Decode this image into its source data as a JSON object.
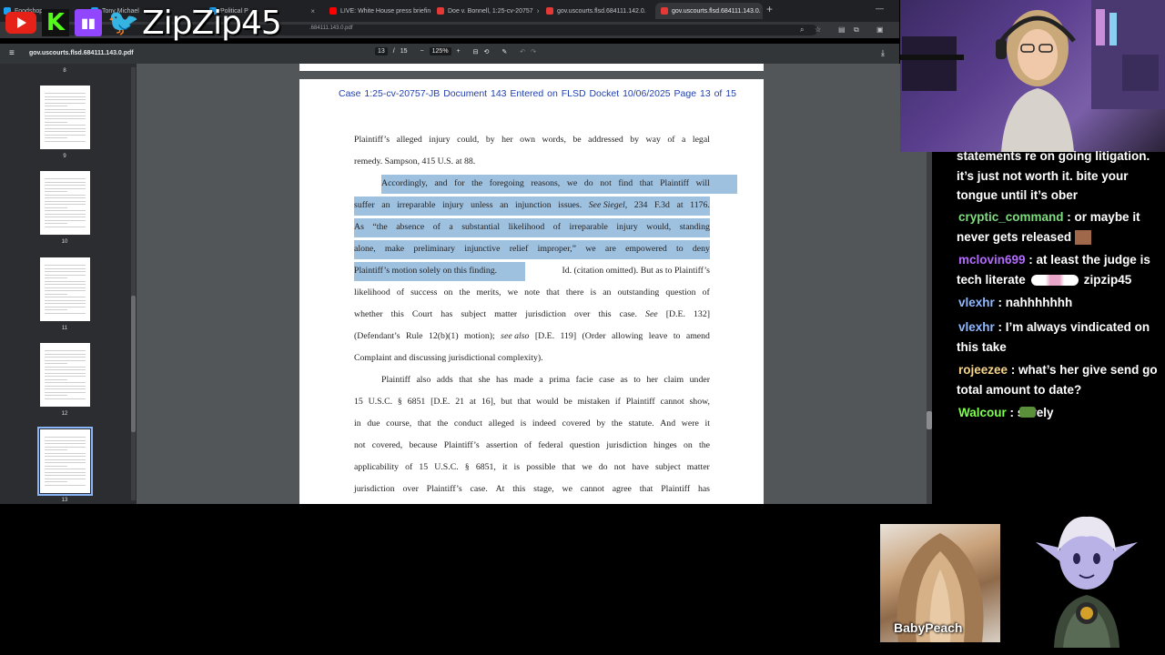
{
  "browser": {
    "tabs": [
      {
        "label": "Foodshops",
        "color": "#1da1f2"
      },
      {
        "label": "Tony Michael",
        "color": "#1da1f2"
      },
      {
        "label": "Political P",
        "color": "#1da1f2"
      },
      {
        "label": "LIVE: White House press briefin",
        "color": "#ff0000"
      },
      {
        "label": "Doe v. Bonnell, 1:25-cv-20757",
        "color": "#e53935"
      },
      {
        "label": "gov.uscourts.flsd.684111.142.0.",
        "color": "#e53935"
      },
      {
        "label": "gov.uscourts.flsd.684111.143.0.",
        "color": "#e53935"
      }
    ],
    "url": ".684111.143.0.pdf"
  },
  "overlay": {
    "handle": "ZipZip45",
    "kick_letter": "K"
  },
  "pdf": {
    "title": "gov.uscourts.flsd.684111.143.0.pdf",
    "page_current": "13",
    "page_sep": "/",
    "page_total": "15",
    "zoom": "125%",
    "thumbnails": [
      {
        "num": "8"
      },
      {
        "num": "9"
      },
      {
        "num": "10"
      },
      {
        "num": "11"
      },
      {
        "num": "12"
      },
      {
        "num": "13"
      }
    ],
    "header": "Case 1:25-cv-20757-JB   Document 143   Entered on FLSD Docket 10/06/2025   Page 13 of 15",
    "lines": [
      [
        "Plaintiff’s",
        "alleged",
        "injury",
        "could,",
        "by",
        "her",
        "own",
        "words,",
        "be",
        "addressed",
        "by",
        "way",
        "of",
        "a",
        "legal"
      ],
      "remedy.  Sampson, 415 U.S. at 88.",
      [
        "Accordingly,",
        "and",
        "for",
        "the",
        "foregoing",
        "reasons,",
        "we",
        "do",
        "not",
        "find",
        "that",
        "Plaintiff",
        "will"
      ],
      [
        "suffer",
        "an",
        "irreparable",
        "injury",
        "unless",
        "an",
        "injunction",
        "issues.",
        "See Siegel,",
        "234",
        "F.3d",
        "at",
        "1176."
      ],
      [
        "As",
        "“the",
        "absence",
        "of",
        "a",
        "substantial",
        "likelihood",
        "of",
        "irreparable",
        "injury",
        "would,",
        "standing"
      ],
      [
        "alone,",
        "make",
        "preliminary",
        "injunctive",
        "relief",
        "improper,”",
        "we",
        "are",
        "empowered",
        "to",
        "deny"
      ],
      "Plaintiff’s motion solely on this finding.",
      "Id. (citation omitted).  But as to Plaintiff’s",
      [
        "likelihood",
        "of",
        "success",
        "on",
        "the",
        "merits,",
        "we",
        "note",
        "that",
        "there",
        "is",
        "an",
        "outstanding",
        "question",
        "of"
      ],
      [
        "whether",
        "this",
        "Court",
        "has",
        "subject",
        "matter",
        "jurisdiction",
        "over",
        "this",
        "case.",
        "See",
        "[D.E.",
        "132]"
      ],
      [
        "(Defendant’s",
        "Rule",
        "12(b)(1)",
        "motion);",
        "see also",
        "[D.E.",
        "119]",
        "(Order",
        "allowing",
        "leave",
        "to",
        "amend"
      ],
      "Complaint and discussing jurisdictional complexity).",
      [
        "Plaintiff",
        "also",
        "adds",
        "that",
        "she",
        "has",
        "made",
        "a",
        "prima",
        "facie",
        "case",
        "as",
        "to",
        "her",
        "claim",
        "under"
      ],
      [
        "15",
        "U.S.C.",
        "§",
        "6851",
        "[D.E.",
        "21",
        "at",
        "16],",
        "but",
        "that",
        "would",
        "be",
        "mistaken",
        "if",
        "Plaintiff",
        "cannot",
        "show,"
      ],
      [
        "in",
        "due",
        "course,",
        "that",
        "the",
        "conduct",
        "alleged",
        "is",
        "indeed",
        "covered",
        "by",
        "the",
        "statute.",
        "And",
        "were",
        "it"
      ],
      [
        "not",
        "covered,",
        "because",
        "Plaintiff’s",
        "assertion",
        "of",
        "federal",
        "question",
        "jurisdiction",
        "hinges",
        "on",
        "the"
      ],
      [
        "applicability",
        "of",
        "15",
        "U.S.C.",
        "§",
        "6851,",
        "it",
        "is",
        "possible",
        "that",
        "we",
        "do",
        "not",
        "have",
        "subject",
        "matter"
      ],
      [
        "jurisdiction",
        "over",
        "Plaintiff’s",
        "case.",
        "At",
        "this",
        "stage,",
        "we",
        "cannot",
        "agree",
        "that",
        "Plaintiff",
        "has"
      ]
    ]
  },
  "chat": {
    "messages": [
      {
        "user": "",
        "color": "#ffffff",
        "text": "statements re on going litigation. it’s just not worth it. bite your tongue until it’s ober"
      },
      {
        "user": "cryptic_command",
        "color": "#7fdc7f",
        "text": " : or maybe it never gets released"
      },
      {
        "user": "mclovin699",
        "color": "#b36bff",
        "text": " : at least the judge is tech literate"
      },
      {
        "user": "vlexhr",
        "color": "#8fb8ff",
        "text": " : nahhhhhhh"
      },
      {
        "user": "vlexhr",
        "color": "#8fb8ff",
        "text": " : I’m always vindicated on this take"
      },
      {
        "user": "rojeezee",
        "color": "#f7d58a",
        "text": " : what’s her give send go total amount to date?"
      },
      {
        "user": "Walcour",
        "color": "#7fff4f",
        "text": " :     surely"
      }
    ],
    "emote_text": "zipzip45"
  },
  "bottom": {
    "card_name": "BabyPeach"
  }
}
